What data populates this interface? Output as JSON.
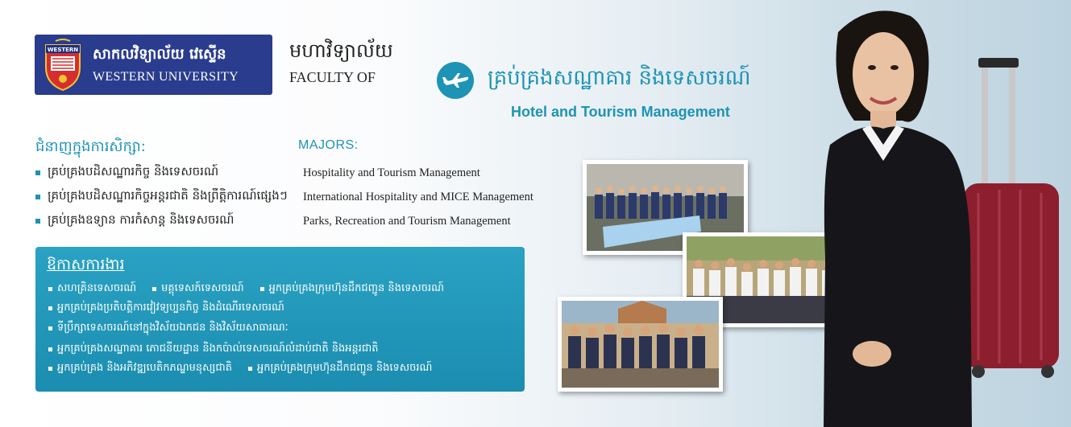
{
  "logo": {
    "khmer": "សាកលវិទ្យាល័យ វេស្ទើន",
    "english": "WESTERN UNIVERSITY",
    "crest_text": "WESTERN",
    "color": "#2a3c8e"
  },
  "faculty": {
    "khmer": "មហាវិទ្យាល័យ",
    "english": "FACULTY OF"
  },
  "department": {
    "icon": "airplane-icon",
    "khmer": "គ្រប់គ្រងសណ្ឋាគារ និងទេសចរណ៍",
    "english": "Hotel and Tourism Management",
    "accent": "#1d93b5"
  },
  "majors": {
    "heading_khmer": "ជំនាញក្នុងការសិក្សា:",
    "heading_english": "MAJORS:",
    "items": [
      {
        "khmer": "គ្រប់គ្រងបដិសណ្ឋារកិច្ច និងទេសចរណ៍",
        "english": "Hospitality and Tourism Management"
      },
      {
        "khmer": "គ្រប់គ្រងបដិសណ្ឋារកិច្ចអន្តរជាតិ និងព្រឹត្តិការណ៍ផ្សេងៗ",
        "english": "International Hospitality and MICE Management"
      },
      {
        "khmer": "គ្រប់គ្រងឧទ្យាន ការកំសាន្ត និងទេសចរណ៍",
        "english": "Parks, Recreation and Tourism Management"
      }
    ]
  },
  "careers": {
    "title": "ឱកាសការងារ",
    "lines": [
      [
        "សហគ្រិនទេសចរណ៍",
        "មគ្គុទេសក៍ទេសចរណ៍",
        "អ្នកគ្រប់គ្រងក្រុមហ៊ុនដឹកជញ្ជូន និងទេសចរណ៍"
      ],
      [
        "អ្នកគ្រប់គ្រងប្រតិបត្តិការវៀវទ្យប្បនកិច្ច និងដំណើរទេសចរណ៍"
      ],
      [
        "ទីប្រឹក្សាទេសចរណ៍នៅក្នុងវិស័យឯកជន និងវិស័យសាធារណៈ"
      ],
      [
        "អ្នកគ្រប់គ្រងសណ្ឋាគារ ភោជនីយដ្ឋាន និងកប៉ាល់ទេសចរណ៍លំដាប់ជាតិ និងអន្តរជាតិ"
      ],
      [
        "អ្នកគ្រប់គ្រង និងអភិវឌ្ឍបេតិកភណ្ឌមនុស្សជាតិ",
        "អ្នកគ្រប់គ្រងក្រុមហ៊ុនដឹកជញ្ជូន និងទេសចរណ៍"
      ]
    ]
  }
}
